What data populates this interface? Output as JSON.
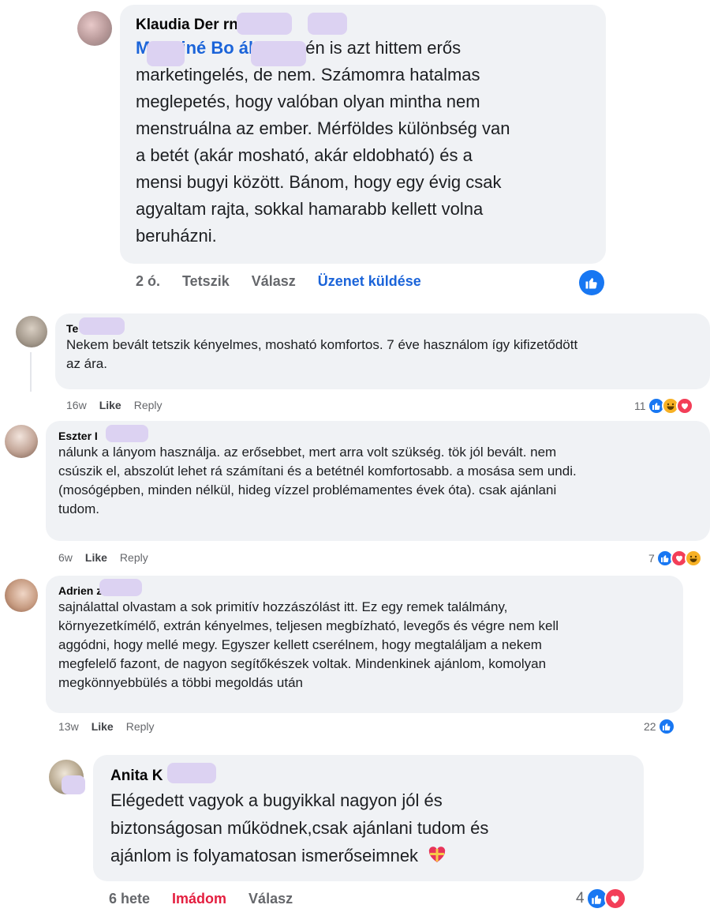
{
  "thread_top": {
    "author": "Klaudia Der   rné S   s",
    "mention": "M   resiné Bo   áki Rita",
    "text_line1": "én is azt hittem erős",
    "lines": [
      "marketingelés, de nem. Számomra hatalmas",
      "meglepetés, hogy valóban olyan mintha nem",
      "menstruálna az ember. Mérföldes különbség van",
      "a betét (akár mosható, akár eldobható) és a",
      "mensi bugyi között. Bánom, hogy egy évig csak",
      "agyaltam rajta, sokkal hamarabb kellett volna",
      "beruházni."
    ],
    "time": "2 ó.",
    "like": "Tetszik",
    "reply": "Válasz",
    "message": "Üzenet küldése"
  },
  "comments": [
    {
      "author": "Te",
      "lines": [
        "Nekem bevált tetszik kényelmes, mosható komfortos. 7 éve használom így kifizetődött",
        "az ára."
      ],
      "time": "16w",
      "like": "Like",
      "reply": "Reply",
      "count": "11"
    },
    {
      "author": "Eszter I",
      "lines": [
        "nálunk a lányom használja. az erősebbet, mert arra volt szükség. tök jól bevált. nem",
        "csúszik el, abszolút lehet rá számítani és a betétnél komfortosabb. a mosása sem undi.",
        "(mosógépben, minden nélkül, hideg vízzel problémamentes évek óta). csak ajánlani",
        "tudom."
      ],
      "time": "6w",
      "like": "Like",
      "reply": "Reply",
      "count": "7"
    },
    {
      "author": "Adrien   z",
      "lines": [
        "sajnálattal olvastam a sok primitív hozzászólást itt. Ez egy remek találmány,",
        "környezetkímélő, extrán kényelmes, teljesen megbízható, levegős és végre nem kell",
        "aggódni, hogy mellé megy. Egyszer kellett cserélnem, hogy megtaláljam a nekem",
        "megfelelő fazont, de nagyon segítőkészek voltak. Mindenkinek ajánlom, komolyan",
        "megkönnyebbülés a többi megoldás után"
      ],
      "time": "13w",
      "like": "Like",
      "reply": "Reply",
      "count": "22"
    }
  ],
  "thread_bottom": {
    "author": "Anita K   i",
    "lines": [
      "Elégedett vagyok a bugyikkal nagyon jól és",
      "biztonságosan működnek,csak ajánlani tudom és",
      "ajánlom is folyamatosan ismerőseimnek"
    ],
    "time": "6 hete",
    "love": "Imádom",
    "reply": "Válasz",
    "count": "4"
  },
  "colors": {
    "bubble": "#f0f2f5",
    "link": "#1b64d9",
    "meta": "#65676b",
    "love": "#e41e3f",
    "like_blue": "#1877f2"
  }
}
